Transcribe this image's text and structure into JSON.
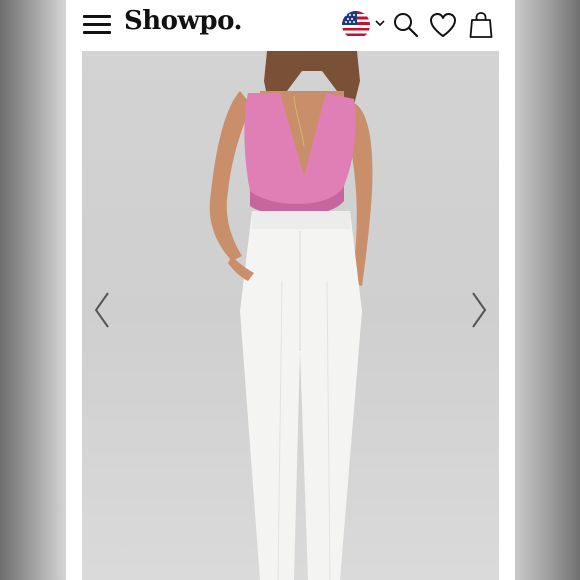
{
  "header": {
    "brand": "Showpo.",
    "icons": {
      "menu": "hamburger-menu-icon",
      "flag": "us-flag-icon",
      "region_chevron": "chevron-down-icon",
      "search": "search-icon",
      "wishlist": "heart-icon",
      "bag": "shopping-bag-icon"
    }
  },
  "hero": {
    "image": "model-pink-wrap-top-white-pants",
    "arrows": [
      "chevron-left-icon",
      "chevron-right-icon"
    ]
  },
  "colors": {
    "text": "#111111",
    "top": "#e07fb6",
    "pants": "#f4f4f2",
    "background": "#d3d3d3"
  }
}
